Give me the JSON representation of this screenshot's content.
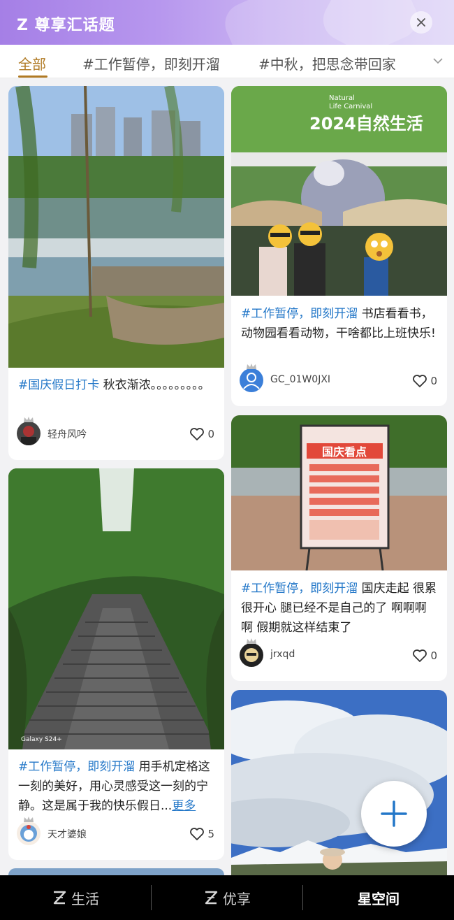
{
  "header": {
    "title": "Z 尊享汇话题"
  },
  "tabs": [
    {
      "label": "全部",
      "active": true
    },
    {
      "label": "#工作暂停，即刻开溜",
      "active": false
    },
    {
      "label": "#中秋，把思念带回家",
      "active": false
    }
  ],
  "posts": [
    {
      "hashtag": "#国庆假日打卡",
      "body": " 秋衣渐浓。。。。。。。。。",
      "more": "",
      "username": "轻舟风吟",
      "likes": "0"
    },
    {
      "hashtag": "#工作暂停，即刻开溜",
      "body": " 书店看看书，动物园看看动物，干啥都比上班快乐!",
      "more": "",
      "username": "GC_01W0JXI",
      "likes": "0"
    },
    {
      "hashtag": "#工作暂停，即刻开溜",
      "body": " 国庆走起 很累很开心 腿已经不是自己的了 啊啊啊啊 假期就这样结束了",
      "more": "",
      "username": "jrxqd",
      "likes": "0"
    },
    {
      "hashtag": "#工作暂停，即刻开溜",
      "body": " 用手机定格这一刻的美好，用心灵感受这一刻的宁静。这是属于我的快乐假日...",
      "more": "更多",
      "username": "天才婆娘",
      "likes": "5"
    }
  ],
  "image_texts": {
    "banner_line1": "Natural",
    "banner_line2": "Life Carnival",
    "banner_year": "2024自然生活",
    "sign_title": "国庆看点",
    "watermark": "Galaxy S24+"
  },
  "bottom_nav": [
    {
      "label": "生活",
      "active": false
    },
    {
      "label": "优享",
      "active": false
    },
    {
      "label": "星空间",
      "active": true
    }
  ],
  "colors": {
    "accent": "#b07a24",
    "hashtag": "#2377c8",
    "header_gradient_start": "#a57fe6"
  }
}
